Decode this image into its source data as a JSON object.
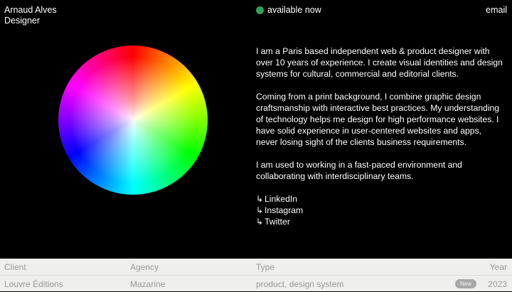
{
  "header": {
    "name": "Arnaud Alves",
    "role": "Designer",
    "status": "available now",
    "email": "email",
    "status_color": "#2fa25a"
  },
  "bio": {
    "paragraphs": [
      "I am a Paris based independent web & product designer with over 10 years of experience. I create visual identities and design systems for cultural, commercial and editorial clients.",
      "Coming from a print background, I combine graphic design craftsmanship with interactive best practices. My understanding of technology helps me design for high performance websites. I have solid experience in user-centered websites and apps, never losing sight of the clients business requirements.",
      "I am used to working in a fast-paced environment and collaborating with interdisciplinary teams."
    ],
    "links": [
      {
        "arrow": "↳",
        "label": "LinkedIn"
      },
      {
        "arrow": "↳",
        "label": "Instagram"
      },
      {
        "arrow": "↳",
        "label": "Twitter"
      }
    ]
  },
  "table": {
    "headers": [
      "Client",
      "Agency",
      "Type",
      "Year"
    ],
    "rows": [
      {
        "client": "Louvre Éditions",
        "agency": "Mazarine",
        "type": "product, design system",
        "badge": "New",
        "year": "2023"
      }
    ]
  }
}
